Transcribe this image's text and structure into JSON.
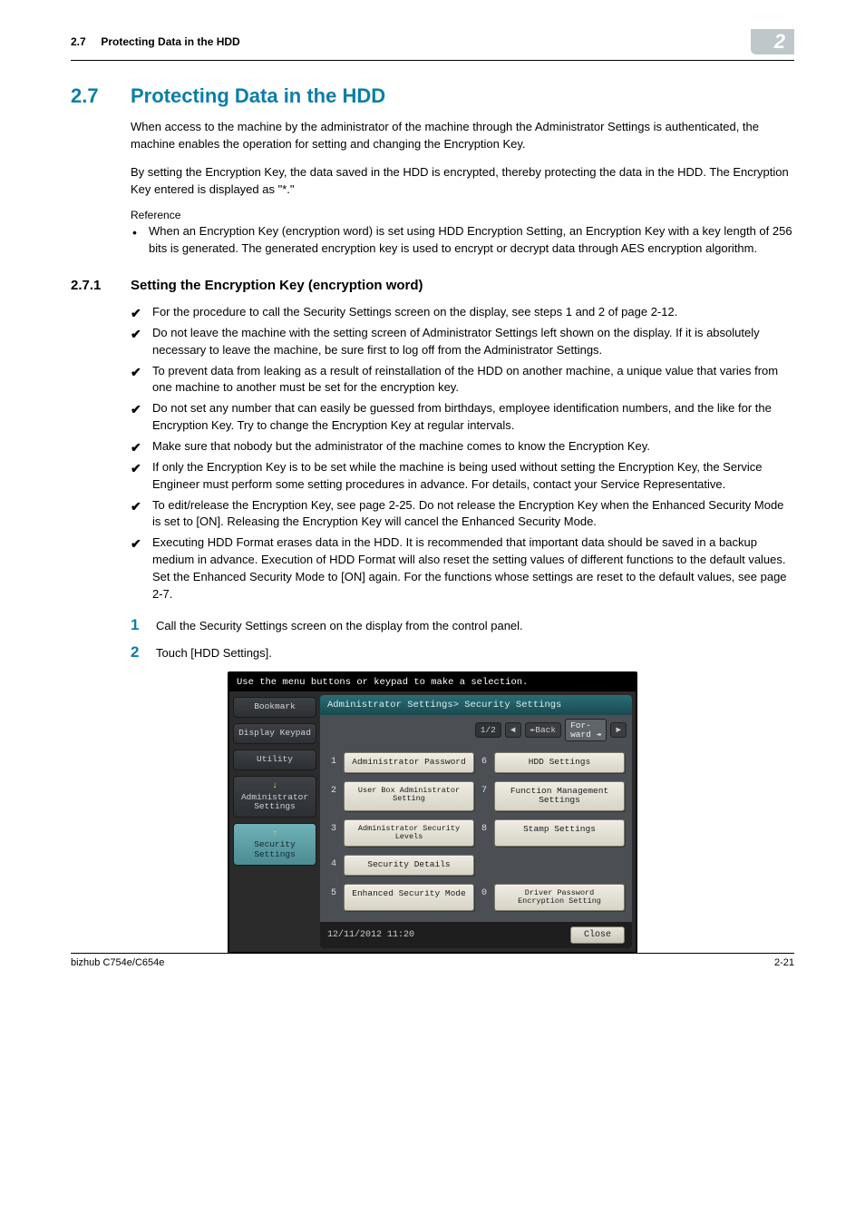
{
  "header": {
    "section_ref": "2.7",
    "section_ref_title": "Protecting Data in the HDD",
    "chapter_badge": "2"
  },
  "s1": {
    "num": "2.7",
    "title": "Protecting Data in the HDD",
    "p1": "When access to the machine by the administrator of the machine through the Administrator Settings is authenticated, the machine enables the operation for setting and changing the Encryption Key.",
    "p2": "By setting the Encryption Key, the data saved in the HDD is encrypted, thereby protecting the data in the HDD. The Encryption Key entered is displayed as \"*.\"",
    "ref_label": "Reference",
    "ref_bullet": "When an Encryption Key (encryption word) is set using HDD Encryption Setting, an Encryption Key with a key length of 256 bits is generated. The generated encryption key is used to encrypt or decrypt data through AES encryption algorithm."
  },
  "s2": {
    "num": "2.7.1",
    "title": "Setting the Encryption Key (encryption word)",
    "checks": [
      "For the procedure to call the Security Settings screen on the display, see steps 1 and 2 of page 2-12.",
      "Do not leave the machine with the setting screen of Administrator Settings left shown on the display. If it is absolutely necessary to leave the machine, be sure first to log off from the Administrator Settings.",
      "To prevent data from leaking as a result of reinstallation of the HDD on another machine, a unique value that varies from one machine to another must be set for the encryption key.",
      "Do not set any number that can easily be guessed from birthdays, employee identification numbers, and the like for the Encryption Key. Try to change the Encryption Key at regular intervals.",
      "Make sure that nobody but the administrator of the machine comes to know the Encryption Key.",
      "If only the Encryption Key is to be set while the machine is being used without setting the Encryption Key, the Service Engineer must perform some setting procedures in advance. For details, contact your Service Representative.",
      "To edit/release the Encryption Key, see page 2-25. Do not release the Encryption Key when the Enhanced Security Mode is set to [ON]. Releasing the Encryption Key will cancel the Enhanced Security Mode.",
      "Executing HDD Format erases data in the HDD. It is recommended that important data should be saved in a backup medium in advance. Execution of HDD Format will also reset the setting values of different functions to the default values. Set the Enhanced Security Mode to [ON] again. For the functions whose settings are reset to the default values, see page 2-7."
    ],
    "steps": [
      {
        "n": "1",
        "t": "Call the Security Settings screen on the display from the control panel."
      },
      {
        "n": "2",
        "t": "Touch [HDD Settings]."
      }
    ]
  },
  "device": {
    "topbar": "Use the menu buttons or keypad to make a selection.",
    "sidebar": {
      "bookmark": "Bookmark",
      "display_keypad": "Display Keypad",
      "utility": "Utility",
      "admin": "Administrator\nSettings",
      "security": "Security\nSettings"
    },
    "breadcrumb": "Administrator Settings> Security Settings",
    "pager": {
      "page": "1/2",
      "back": "↞Back",
      "fwd": "For-\nward ↠"
    },
    "menu": {
      "n1": "1",
      "b1": "Administrator Password",
      "n2": "2",
      "b2": "User Box Administrator\nSetting",
      "n3": "3",
      "b3": "Administrator Security\nLevels",
      "n4": "4",
      "b4": "Security Details",
      "n5": "5",
      "b5": "Enhanced Security Mode",
      "n6": "6",
      "b6": "HDD Settings",
      "n7": "7",
      "b7": "Function Management Settings",
      "n8": "8",
      "b8": "Stamp Settings",
      "n0": "0",
      "b0": "Driver Password\nEncryption Setting"
    },
    "footer_time": "12/11/2012  11:20",
    "close": "Close"
  },
  "footer": {
    "left": "bizhub C754e/C654e",
    "right": "2-21"
  }
}
